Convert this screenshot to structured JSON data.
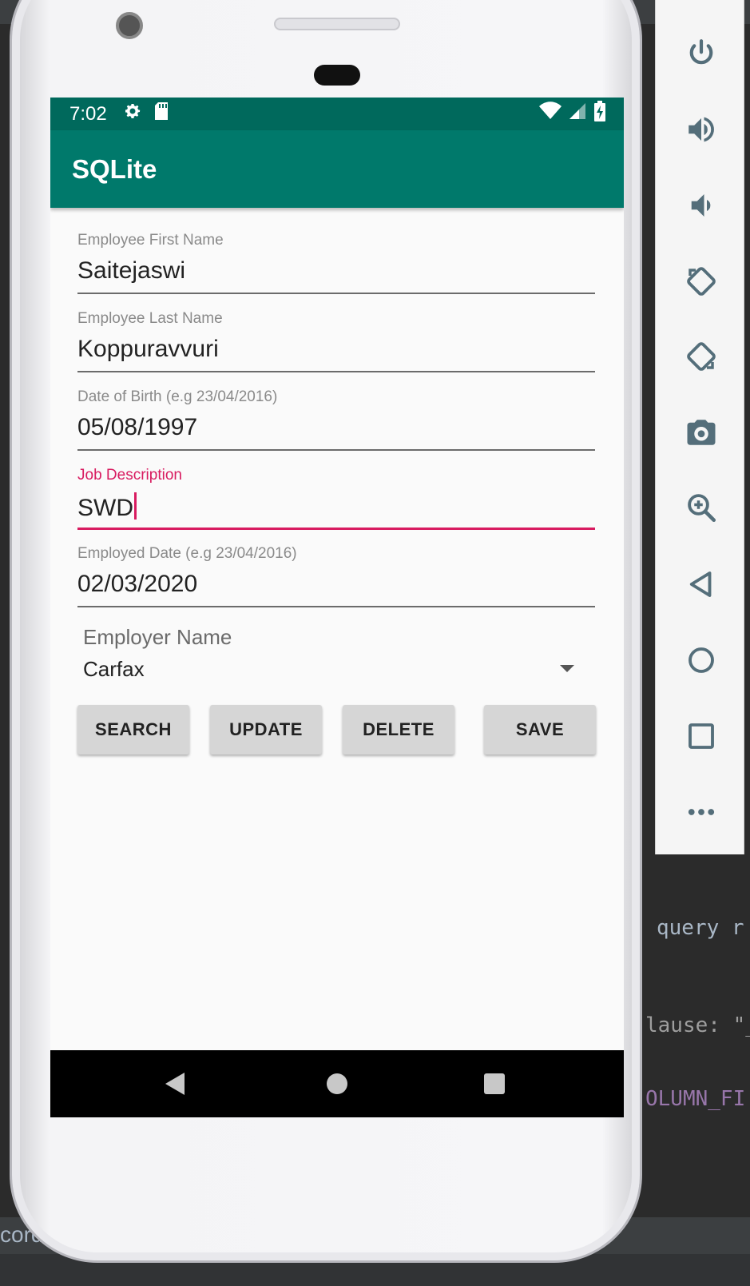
{
  "status_bar": {
    "time": "7:02"
  },
  "app_bar": {
    "title": "SQLite"
  },
  "form": {
    "first_name": {
      "label": "Employee First Name",
      "value": "Saitejaswi"
    },
    "last_name": {
      "label": "Employee Last Name",
      "value": "Koppuravvuri"
    },
    "dob": {
      "label": "Date of Birth (e.g 23/04/2016)",
      "value": "05/08/1997"
    },
    "job": {
      "label": "Job Description",
      "value": "SWD"
    },
    "employed": {
      "label": "Employed Date (e.g 23/04/2016)",
      "value": "02/03/2020"
    },
    "employer": {
      "label": "Employer Name",
      "value": "Carfax"
    }
  },
  "buttons": {
    "search": "SEARCH",
    "update": "UPDATE",
    "delete": "DELETE",
    "save": "SAVE"
  },
  "ide": {
    "query_text": "query r",
    "clause_text": "lause: \"_i",
    "column_text": "OLUMN_FI",
    "bottom_text": "cordi"
  },
  "emulator_toolbar": [
    "power-icon",
    "volume-up-icon",
    "volume-down-icon",
    "rotate-left-icon",
    "rotate-right-icon",
    "camera-icon",
    "zoom-icon",
    "back-icon",
    "home-icon",
    "overview-icon",
    "more-icon"
  ],
  "colors": {
    "status_bar": "#00695c",
    "app_bar": "#00796b",
    "accent": "#d81b60"
  }
}
